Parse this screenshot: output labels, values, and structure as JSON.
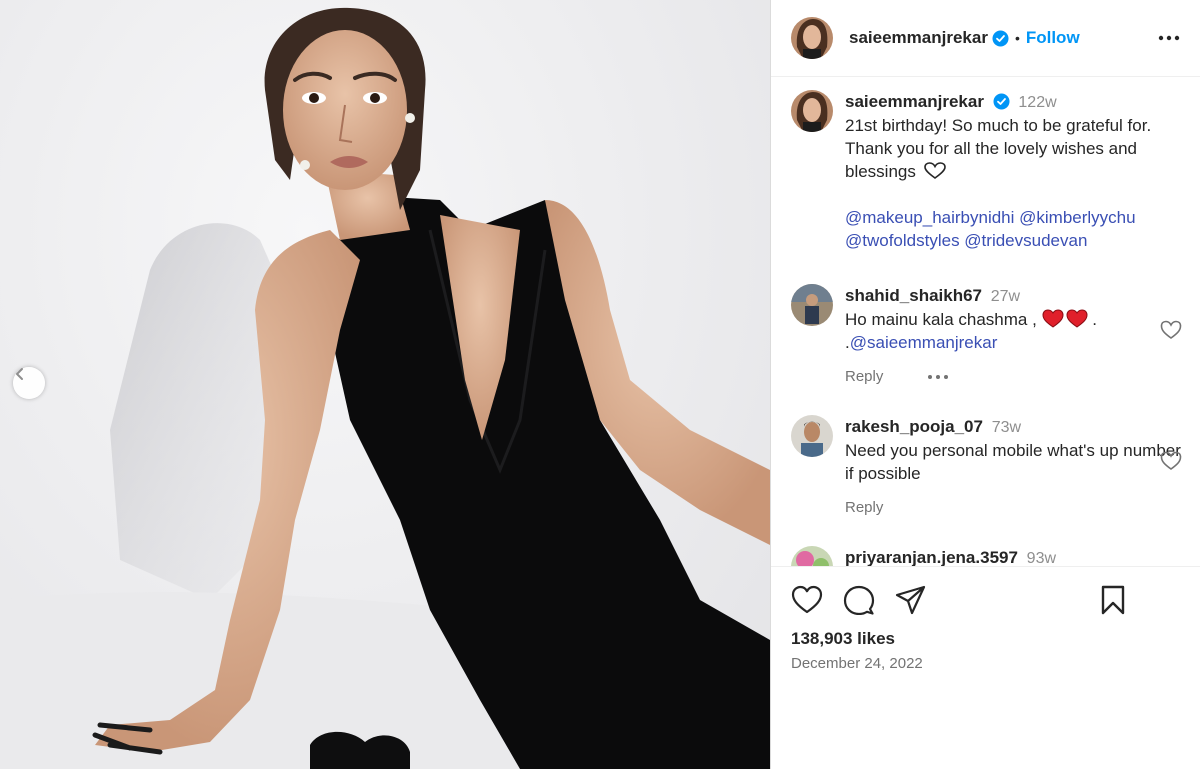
{
  "post": {
    "username": "saieemmanjrekar",
    "follow_label": "Follow",
    "separator": "•"
  },
  "caption": {
    "username": "saieemmanjrekar",
    "time": "122w",
    "text": "21st birthday! So much to be grateful for. Thank you for all the lovely wishes and blessings",
    "mentions_line1": "@makeup_hairbynidhi @kimberlyychu",
    "mentions_line2": "@twofoldstyles @tridevsudevan"
  },
  "comments": [
    {
      "username": "shahid_shaikh67",
      "time": "27w",
      "text": "Ho mainu kala chashma ,",
      "text2": ".",
      "mention_prefix": ".",
      "mention": "@saieemmanjrekar",
      "reply_label": "Reply"
    },
    {
      "username": "rakesh_pooja_07",
      "time": "73w",
      "text": "Need you personal mobile what's up number if possible",
      "reply_label": "Reply"
    },
    {
      "username": "priyaranjan.jena.3597",
      "time": "93w"
    }
  ],
  "footer": {
    "likes": "138,903 likes",
    "date": "December 24, 2022"
  },
  "icons": {
    "verified_color": "#0095f6",
    "heart_red": "#e0202b",
    "accent": "#0095f6"
  }
}
